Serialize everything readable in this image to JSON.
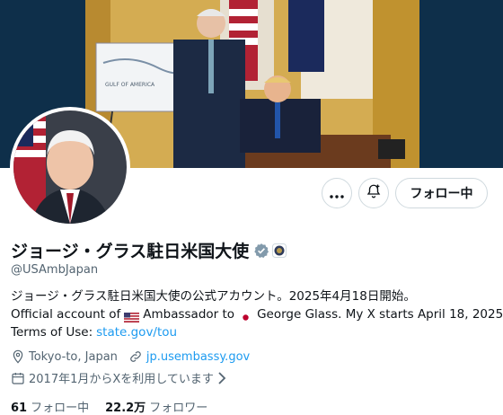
{
  "profile": {
    "display_name": "ジョージ・グラス駐日米国大使",
    "handle": "@USAmbJapan",
    "follow_button": "フォロー中",
    "bio": {
      "line1": "ジョージ・グラス駐日米国大使の公式アカウント。2025年4月18日開始。",
      "line2_a": "Official account of",
      "line2_b": "Ambassador to",
      "line2_c": "George Glass. My X starts April 18, 2025.",
      "line3_prefix": "Terms of Use:",
      "line3_link": "state.gov/tou"
    },
    "location": "Tokyo-to, Japan",
    "website": "jp.usembassy.gov",
    "joined": "2017年1月からXを利用しています",
    "following_count": "61",
    "following_label": "フォロー中",
    "followers_count": "22.2万",
    "followers_label": "フォロワー",
    "banner_map_text": "GULF OF AMERICA"
  },
  "colors": {
    "accent": "#1d9bf0",
    "verified_gray": "#829aab",
    "banner_bg": "#0e2f4a"
  },
  "icons": [
    "more-icon",
    "notification-bell-icon",
    "verified-badge-icon",
    "affiliate-seal-icon",
    "location-icon",
    "link-icon",
    "calendar-icon",
    "chevron-right-icon",
    "us-flag-icon",
    "japan-flag-icon"
  ]
}
